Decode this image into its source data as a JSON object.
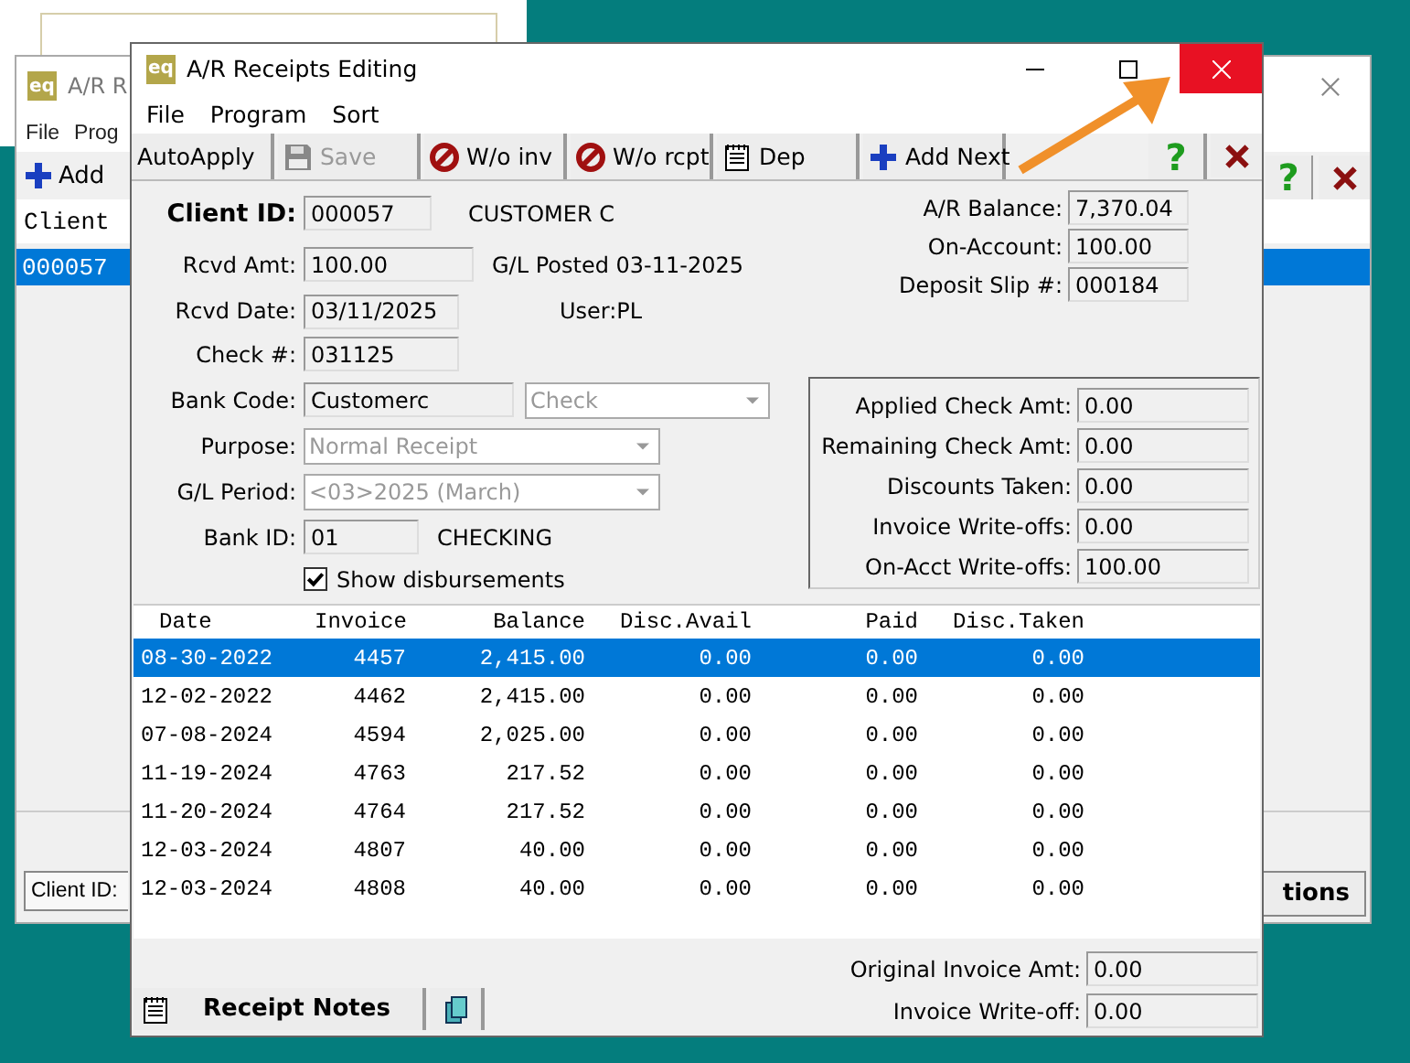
{
  "back_window": {
    "logo": "eq",
    "title": "A/R R",
    "menu": [
      "File",
      "Prog"
    ],
    "add_button": "Add",
    "columns": [
      "Client"
    ],
    "rows": [
      {
        "cells": [
          "000057"
        ],
        "selected": true
      }
    ],
    "client_id_label": "Client ID:",
    "help": "?",
    "button": "tions"
  },
  "window": {
    "logo": "eq",
    "title": "A/R Receipts Editing"
  },
  "menu": [
    "File",
    "Program",
    "Sort"
  ],
  "toolbar": [
    {
      "label": "AutoApply",
      "disabled": false
    },
    {
      "label": "Save",
      "disabled": true
    },
    {
      "label": "W/o inv",
      "disabled": false
    },
    {
      "label": "W/o rcpt",
      "disabled": false
    },
    {
      "label": "Dep",
      "disabled": false
    },
    {
      "label": "Add Next",
      "disabled": false
    }
  ],
  "help": "?",
  "left_fields": [
    {
      "kind": "key",
      "label": "Client ID:",
      "value": "000057",
      "note": "CUSTOMER C"
    },
    {
      "kind": "text",
      "label": "Rcvd Amt:",
      "value": "100.00",
      "note": "G/L Posted 03-11-2025"
    },
    {
      "kind": "text",
      "label": "Rcvd Date:",
      "value": "03/11/2025",
      "note": "User:PL"
    },
    {
      "kind": "text",
      "label": "Check #:",
      "value": "031125"
    },
    {
      "kind": "text",
      "label": "Bank Code:",
      "value": "Customerc",
      "dropdown": {
        "value": "Check",
        "disabled": true
      }
    },
    {
      "kind": "dropdown",
      "label": "Purpose:",
      "value": "Normal Receipt",
      "disabled": true
    },
    {
      "kind": "dropdown",
      "label": "G/L Period:",
      "value": "<03>2025 (March)",
      "disabled": true
    },
    {
      "kind": "text",
      "label": "Bank ID:",
      "value": "01",
      "note": "CHECKING"
    },
    {
      "kind": "checkbox",
      "label": "Show disbursements",
      "checked": true
    }
  ],
  "right_fields": [
    {
      "label": "A/R Balance:",
      "value": "7,370.04"
    },
    {
      "label": "On-Account:",
      "value": "100.00"
    },
    {
      "label": "Deposit Slip #:",
      "value": "000184"
    }
  ],
  "totals": [
    {
      "label": "Applied Check Amt:",
      "value": "0.00"
    },
    {
      "label": "Remaining Check Amt:",
      "value": "0.00"
    },
    {
      "label": "Discounts Taken:",
      "value": "0.00"
    },
    {
      "label": "Invoice Write-offs:",
      "value": "0.00"
    },
    {
      "label": "On-Acct Write-offs:",
      "value": "100.00"
    }
  ],
  "table": {
    "columns": [
      "Date",
      "Invoice",
      "Balance",
      "Disc.Avail",
      "Paid",
      "Disc.Taken"
    ],
    "rows": [
      {
        "cells": [
          "08-30-2022",
          "4457",
          "2,415.00",
          "0.00",
          "0.00",
          "0.00"
        ],
        "selected": true
      },
      {
        "cells": [
          "12-02-2022",
          "4462",
          "2,415.00",
          "0.00",
          "0.00",
          "0.00"
        ],
        "selected": false
      },
      {
        "cells": [
          "07-08-2024",
          "4594",
          "2,025.00",
          "0.00",
          "0.00",
          "0.00"
        ],
        "selected": false
      },
      {
        "cells": [
          "11-19-2024",
          "4763",
          "217.52",
          "0.00",
          "0.00",
          "0.00"
        ],
        "selected": false
      },
      {
        "cells": [
          "11-20-2024",
          "4764",
          "217.52",
          "0.00",
          "0.00",
          "0.00"
        ],
        "selected": false
      },
      {
        "cells": [
          "12-03-2024",
          "4807",
          "40.00",
          "0.00",
          "0.00",
          "0.00"
        ],
        "selected": false
      },
      {
        "cells": [
          "12-03-2024",
          "4808",
          "40.00",
          "0.00",
          "0.00",
          "0.00"
        ],
        "selected": false
      }
    ]
  },
  "notes_button": "Receipt Notes",
  "bottom_fields": [
    {
      "label": "Original Invoice Amt:",
      "value": "0.00"
    },
    {
      "label": "Invoice Write-off:",
      "value": "0.00"
    }
  ]
}
